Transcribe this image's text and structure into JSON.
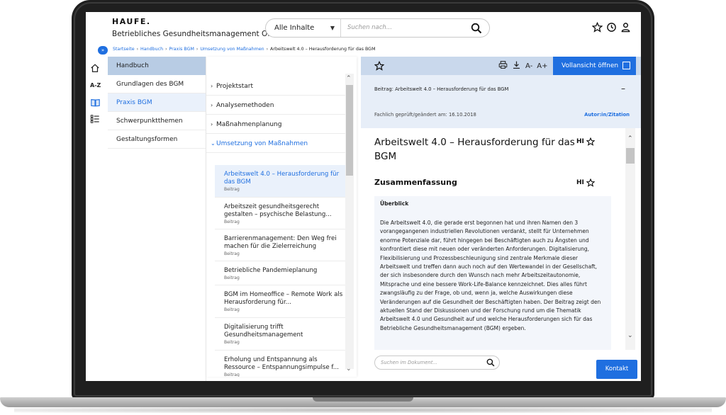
{
  "header": {
    "logo": "HAUFE.",
    "app_title": "Betriebliches Gesundheitsmanagement Office",
    "scope_select": "Alle Inhalte",
    "search_placeholder": "Suchen nach..."
  },
  "breadcrumb": {
    "items": [
      "Startseite",
      "Handbuch",
      "Praxis BGM",
      "Umsetzung von Maßnahmen"
    ],
    "current": "Arbeitswelt 4.0 – Herausforderung für das BGM"
  },
  "rail": {
    "az_label": "A-Z"
  },
  "nav": {
    "header": "Handbuch",
    "items": [
      {
        "label": "Grundlagen des BGM"
      },
      {
        "label": "Praxis BGM"
      },
      {
        "label": "Schwerpunktthemen"
      },
      {
        "label": "Gestaltungsformen"
      }
    ]
  },
  "tree": {
    "sections": [
      {
        "label": "Projektstart"
      },
      {
        "label": "Analysemethoden"
      },
      {
        "label": "Maßnahmenplanung"
      },
      {
        "label": "Umsetzung von Maßnahmen"
      }
    ],
    "articles": [
      {
        "title": "Arbeitswelt 4.0 – Herausforderung für das BGM",
        "type": "Beitrag"
      },
      {
        "title": "Arbeitszeit gesundheitsgerecht gestalten – psychische Belastung...",
        "type": "Beitrag"
      },
      {
        "title": "Barrierenmanagement: Den Weg frei machen für die Zielerreichung",
        "type": "Beitrag"
      },
      {
        "title": "Betriebliche Pandemieplanung",
        "type": "Beitrag"
      },
      {
        "title": "BGM im Homeoffice – Remote Work als Herausforderung für...",
        "type": "Beitrag"
      },
      {
        "title": "Digitalisierung trifft Gesundheitsmanagement",
        "type": "Beitrag"
      },
      {
        "title": "Erholung und Entspannung als Ressource – Entspannungsimpulse f...",
        "type": "Beitrag"
      }
    ]
  },
  "doc": {
    "toolbar": {
      "font_smaller": "A-",
      "font_larger": "A+",
      "full_view": "Vollansicht öffnen"
    },
    "meta": {
      "label_prefix": "Beitrag:",
      "label_title": "Arbeitswelt 4.0 – Herausforderung für das BGM",
      "collapse": "–",
      "date": "Fachlich geprüft/geändert am: 16.10.2018",
      "author": "Autor:in/Zitation"
    },
    "title": "Arbeitswelt 4.0 – Herausforderung für das BGM",
    "hl": "HI",
    "summary_heading": "Zusammenfassung",
    "overview_label": "Überblick",
    "overview_text": "Die Arbeitswelt 4.0, die gerade erst begonnen hat und ihren Namen den 3 vorangegangenen industriellen Revolutionen verdankt, stellt für Unternehmen enorme Potenziale dar, führt hingegen bei Beschäftigten auch zu Ängsten und konfrontiert diese mit neuen oder veränderten Anforderungen. Digitalisierung, Flexibilisierung und Prozessbeschleunigung sind zentrale Merkmale dieser Arbeitswelt und treffen dann auch noch auf den Wertewandel in der Gesellschaft, der sich insbesondere durch den Wunsch nach mehr Arbeitszeitautonomie, Mitsprache und eine bessere Work-Life-Balance kennzeichnet. Dies alles führt zwangsläufig zu der Frage, ob und, wenn ja, welche Auswirkungen diese Veränderungen auf die Gesundheit der Beschäftigten haben. Der Beitrag zeigt den aktuellen Stand der Diskussionen und der Forschung rund um die Thematik Arbeitswelt 4.0 und Gesundheit auf und welche Herausforderungen sich für das Betriebliche Gesundheitsmanagement (BGM) ergeben.",
    "search_placeholder": "Suchen im Dokument...",
    "contact": "Kontakt"
  },
  "colors": {
    "accent": "#1f6fe0",
    "nav_header": "#b8cce4",
    "toolbar": "#c9d8ec",
    "meta_bg": "#e7eef8"
  }
}
